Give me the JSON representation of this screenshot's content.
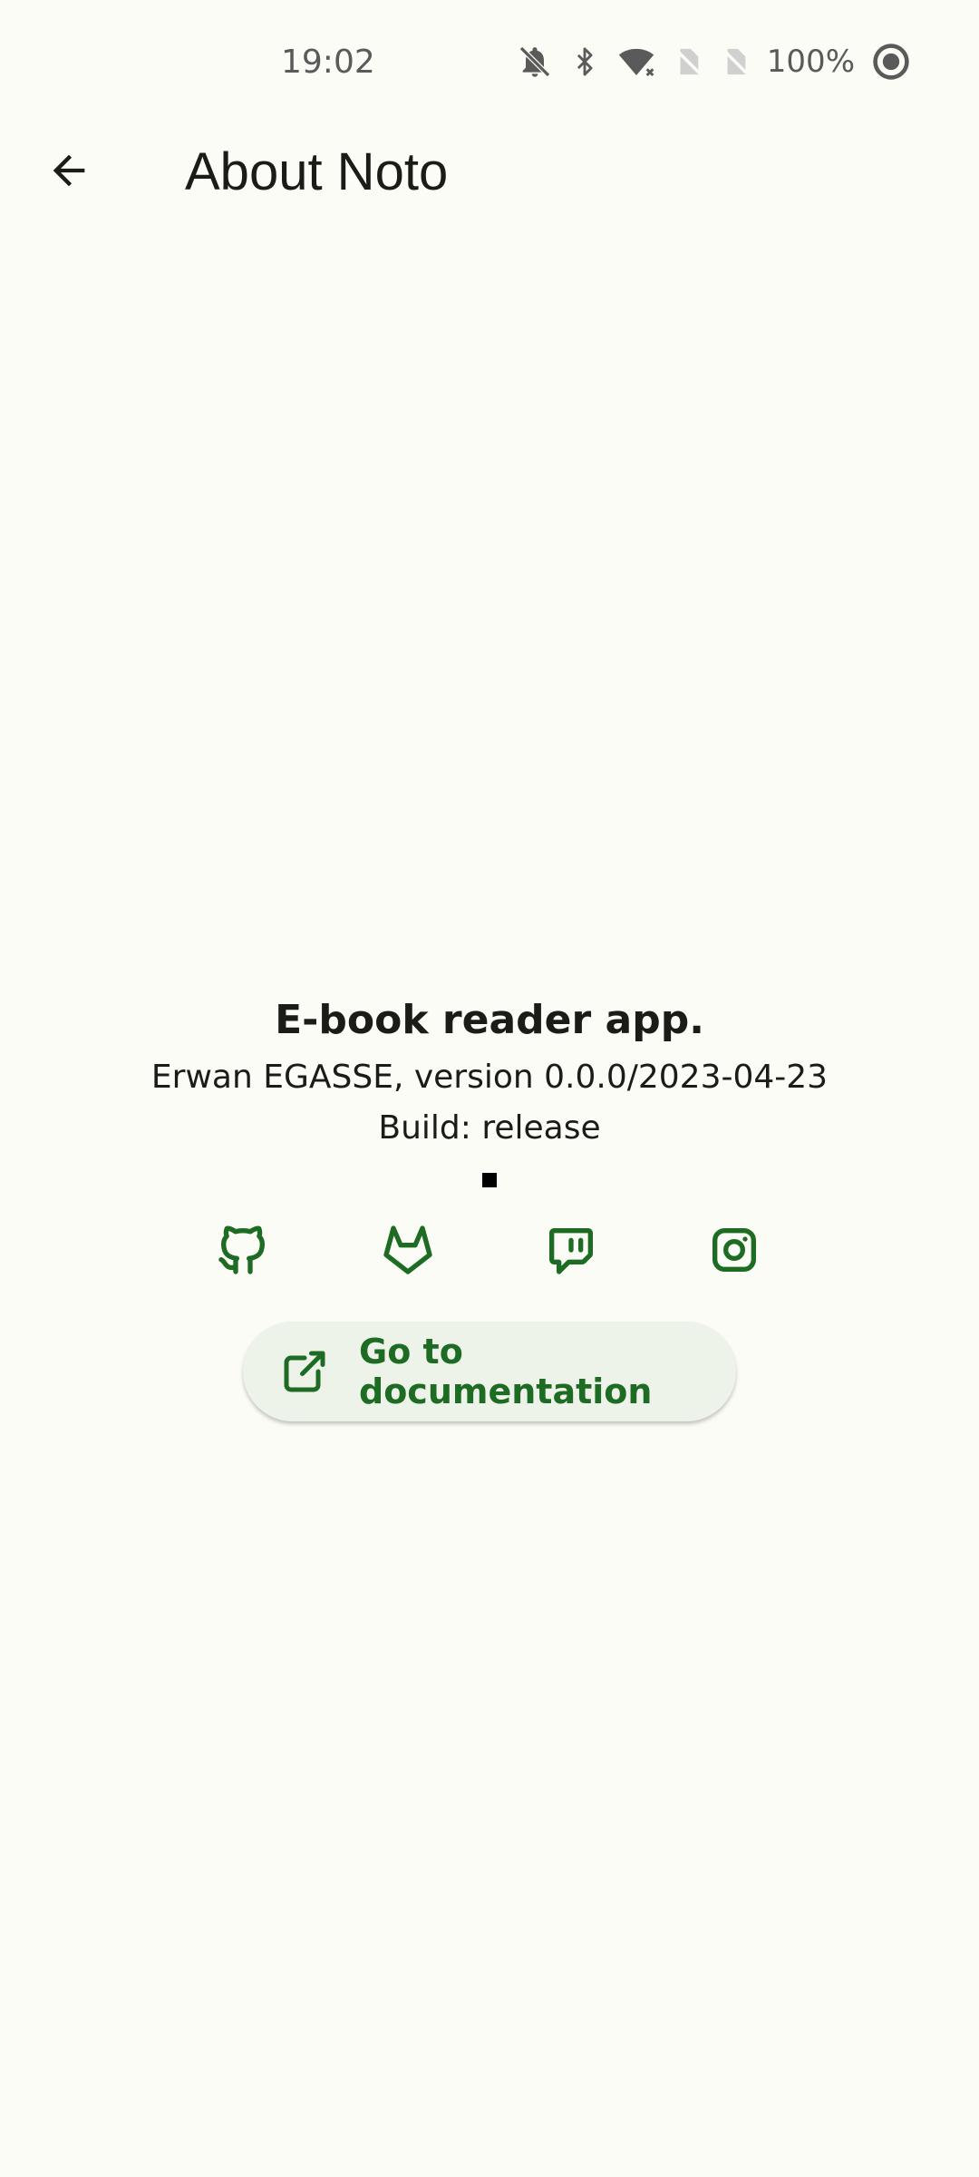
{
  "status_bar": {
    "time": "19:02",
    "battery": "100%",
    "icons": [
      "notifications-off-icon",
      "bluetooth-icon",
      "wifi-icon",
      "no-sim-icon",
      "no-sim-icon",
      "battery-saver-icon"
    ]
  },
  "app_bar": {
    "back_icon": "arrow-back-icon",
    "title": "About Noto"
  },
  "about": {
    "description": "E-book reader app.",
    "author_version": "Erwan EGASSE, version 0.0.0/2023-04-23",
    "build": "Build: release"
  },
  "social_links": [
    {
      "name": "github",
      "icon": "github-icon"
    },
    {
      "name": "gitlab",
      "icon": "gitlab-icon"
    },
    {
      "name": "twitch",
      "icon": "twitch-icon"
    },
    {
      "name": "instagram",
      "icon": "instagram-icon"
    }
  ],
  "documentation_button": {
    "icon": "open-external-icon",
    "label": "Go to documentation"
  },
  "colors": {
    "background": "#fbfcf6",
    "accent": "#1e6b23",
    "button_bg": "#eef3ea",
    "text": "#1b1c18"
  }
}
